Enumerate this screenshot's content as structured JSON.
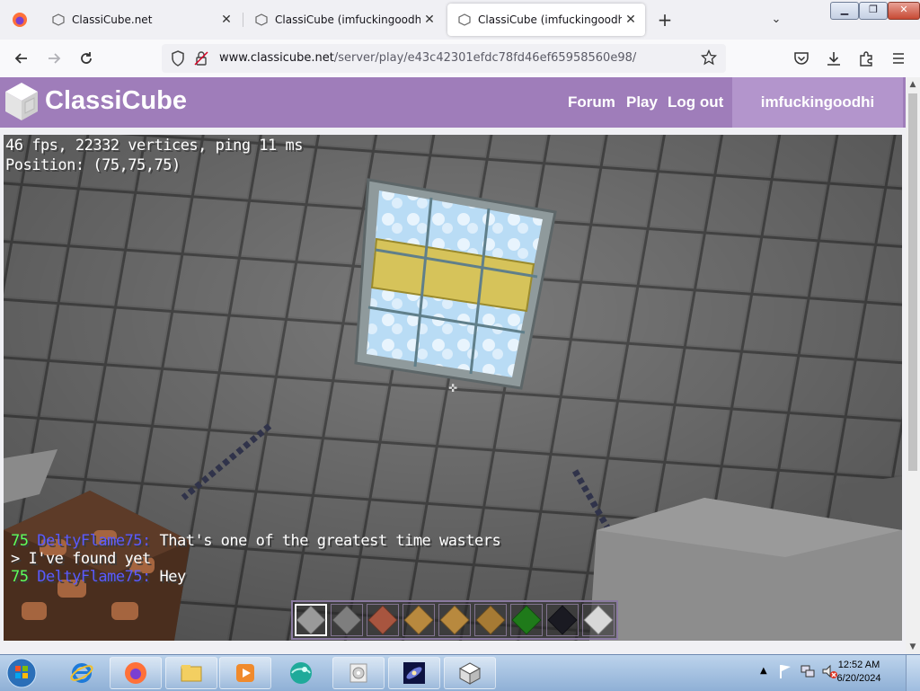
{
  "tabs": [
    {
      "label": "ClassiCube.net",
      "close": "✕"
    },
    {
      "label": "ClassiCube (imfuckingoodhi)",
      "close": "✕"
    },
    {
      "label": "ClassiCube (imfuckingoodhi)",
      "close": "✕"
    }
  ],
  "new_tab": "+",
  "tab_list": "⌄",
  "window_controls": {
    "minimize": "▁",
    "restore": "❐",
    "close": "✕"
  },
  "urlbar": {
    "host": "www.classicube.net",
    "path": "/server/play/e43c42301efdc78fd46ef65958560e98/"
  },
  "site": {
    "brand": "ClassiCube",
    "nav": [
      "Forum",
      "Play",
      "Log out"
    ],
    "username": "imfuckingoodhi"
  },
  "game": {
    "fps_line": "46 fps, 22332 vertices, ping 11 ms",
    "position_line": "Position: (75,75,75)",
    "chat": [
      {
        "prefix": "75 ",
        "name": "DeltyFlame75:",
        "text": " That's one of the greatest time wasters"
      },
      {
        "prefix": "",
        "name": "",
        "text": "> I've found yet"
      },
      {
        "prefix": "75 ",
        "name": "DeltyFlame75:",
        "text": " Hey"
      }
    ],
    "hotbar": {
      "selected_slot": 1,
      "slots": [
        "stone",
        "cobblestone",
        "brick",
        "wood",
        "wood",
        "wood",
        "leaves",
        "obsidian",
        "stone-slab"
      ],
      "colors": [
        "#9a9a9a",
        "#7e7e7e",
        "#a8553f",
        "#b8893e",
        "#b8893e",
        "#a67a34",
        "#1f7a1a",
        "#1a1a22",
        "#d8d8d8"
      ]
    }
  },
  "taskbar": {
    "apps": [
      "internet-explorer",
      "firefox",
      "file-explorer",
      "media-player",
      "globe-app",
      "dvd-app",
      "space-app",
      "classicube-app"
    ],
    "clock_time": "12:52 AM",
    "clock_date": "6/20/2024"
  }
}
